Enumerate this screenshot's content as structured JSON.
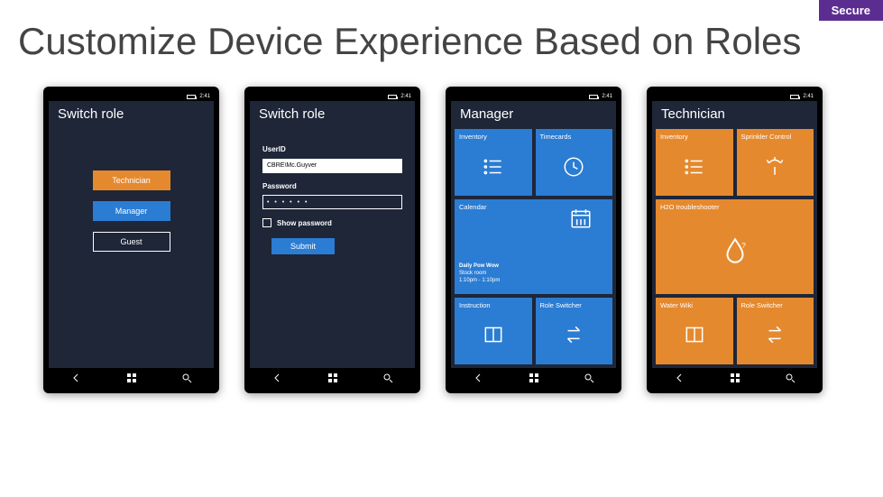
{
  "badge": "Secure",
  "title": "Customize Device Experience Based on Roles",
  "status_time": "2:41",
  "nav": {
    "back": "back-icon",
    "home": "windows-icon",
    "search": "search-icon"
  },
  "screen1": {
    "title": "Switch role",
    "buttons": {
      "technician": "Technician",
      "manager": "Manager",
      "guest": "Guest"
    }
  },
  "screen2": {
    "title": "Switch role",
    "userid_label": "UserID",
    "userid_value": "CBRE\\Mc.Guyver",
    "password_label": "Password",
    "password_value": "• • • • • •",
    "show_password": "Show password",
    "submit": "Submit"
  },
  "screen3": {
    "title": "Manager",
    "tiles": {
      "inventory": "Inventory",
      "timecards": "Timecards",
      "calendar": "Calendar",
      "calendar_body": {
        "line1": "Daily Pow Wow",
        "line2": "Stock room",
        "line3": "1:10pm - 1:10pm"
      },
      "instruction": "Instruction",
      "role_switcher": "Role Switcher"
    }
  },
  "screen4": {
    "title": "Technician",
    "tiles": {
      "inventory": "Inventory",
      "sprinkler": "Sprinkler Control",
      "troubleshooter": "H2O troubleshooter",
      "water_wiki": "Water Wiki",
      "role_switcher": "Role Switcher"
    }
  }
}
